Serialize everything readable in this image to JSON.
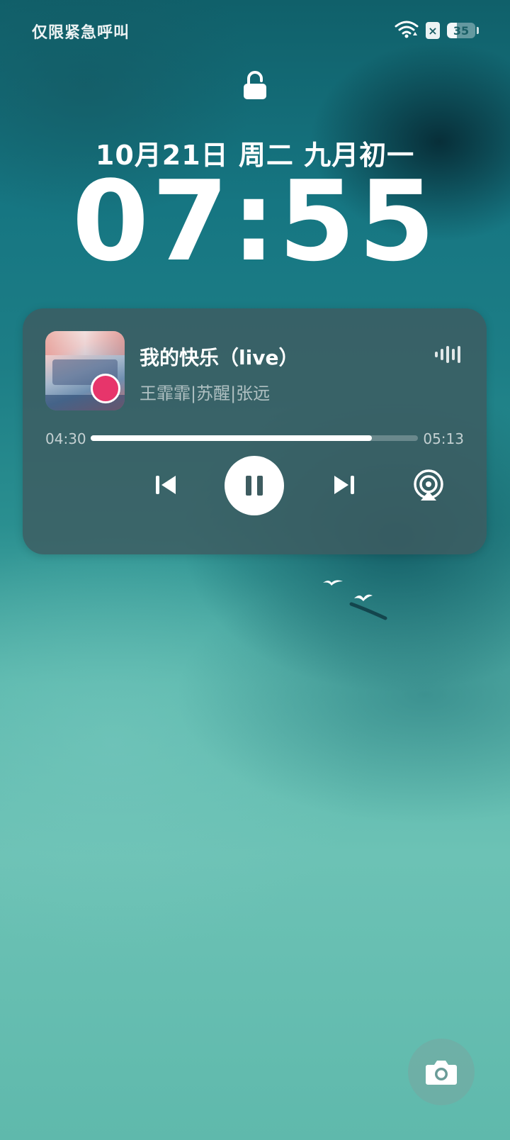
{
  "status_bar": {
    "carrier_text": "仅限紧急呼叫",
    "sim_indicator": "×",
    "battery_level": 35,
    "battery_text": "35",
    "icons": [
      "wifi-icon",
      "no-sim-icon",
      "battery-icon"
    ]
  },
  "lock_screen": {
    "lock_icon": "lock-open-icon",
    "date": "10月21日 周二 九月初一",
    "time": "07:55"
  },
  "media_player": {
    "song_title": "我的快乐（live）",
    "artists": "王霏霏|苏醒|张远",
    "elapsed": "04:30",
    "duration": "05:13",
    "progress_fraction": 0.86,
    "controls": [
      "previous-icon",
      "pause-icon",
      "next-icon",
      "cast-icon"
    ],
    "waveform_icon": "audio-wave-icon"
  },
  "bottom": {
    "camera_icon": "camera-icon"
  }
}
